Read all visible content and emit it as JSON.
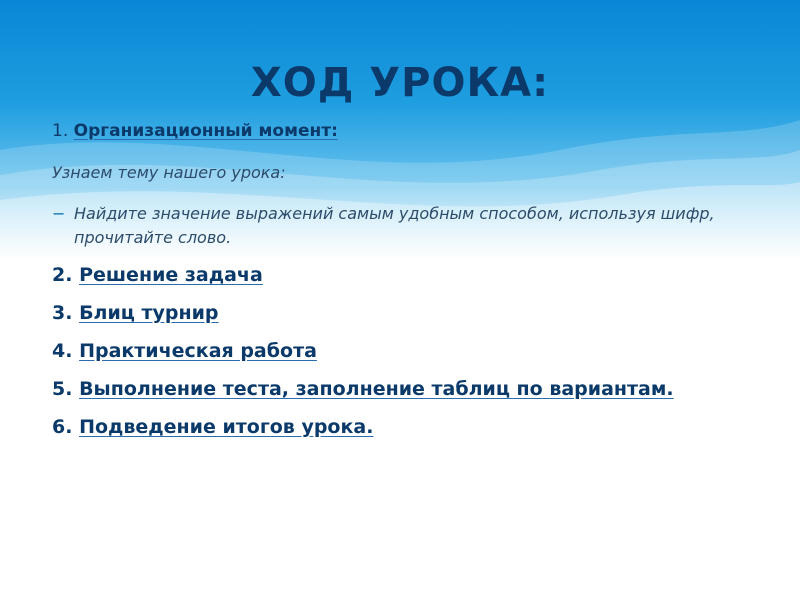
{
  "slide": {
    "title": "ХОД УРОКА:",
    "items": [
      {
        "num": "1. ",
        "label": "Организационный момент:"
      },
      {
        "num": "2. ",
        "label": "Решение задача"
      },
      {
        "num": "3. ",
        "label": "Блиц турнир"
      },
      {
        "num": "4. ",
        "label": "Практическая работа"
      },
      {
        "num": "5. ",
        "label": "Выполнение теста, заполнение таблиц по вариантам."
      },
      {
        "num": "6. ",
        "label": "Подведение итогов урока."
      }
    ],
    "intro": "Узнаем тему нашего урока:",
    "bullet_marker": "−",
    "bullet_text": "Найдите значение выражений самым удобным способом, используя шифр, прочитайте слово."
  },
  "colors": {
    "title": "#0b3a6a",
    "text": "#0b3a6a",
    "header_gradient_top": "#0a86d6"
  }
}
